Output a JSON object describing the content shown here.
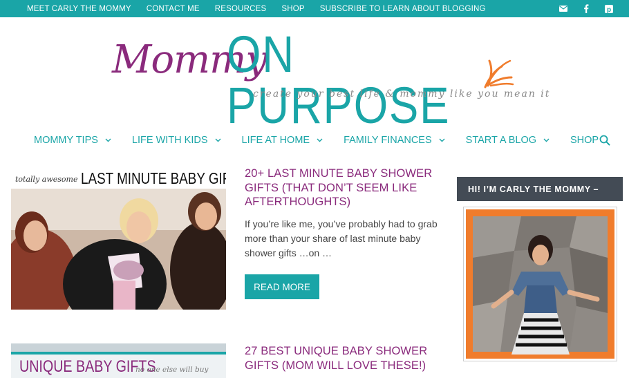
{
  "top_nav": {
    "items": [
      "MEET CARLY THE MOMMY",
      "CONTACT ME",
      "RESOURCES",
      "SHOP",
      "SUBSCRIBE TO LEARN ABOUT BLOGGING"
    ],
    "social_icons": [
      "email-icon",
      "facebook-icon",
      "pinterest-icon"
    ]
  },
  "logo": {
    "script": "Mommy",
    "main": "ON PURPOSE",
    "tagline": "create your best life & mommy like you mean it"
  },
  "main_nav": {
    "items": [
      "MOMMY TIPS",
      "LIFE WITH KIDS",
      "LIFE AT HOME",
      "FAMILY FINANCES",
      "START A BLOG",
      "SHOP"
    ]
  },
  "posts": [
    {
      "image_text_small": "totally awesome",
      "image_text_big": "LAST MINUTE BABY GIFTS",
      "title": "20+ LAST MINUTE BABY SHOWER GIFTS (THAT DON’T SEEM LIKE AFTERTHOUGHTS)",
      "excerpt": "If you’re like me, you’ve probably had to grab more than your share of last minute baby shower gifts …on …",
      "button": "READ MORE"
    },
    {
      "image_text_big": "UNIQUE BABY GIFTS",
      "image_text_small": "no one else will buy",
      "title": "27 BEST UNIQUE BABY SHOWER GIFTS (MOM WILL LOVE THESE!)"
    }
  ],
  "sidebar": {
    "widget_title": "HI! I’M CARLY THE MOMMY –"
  },
  "colors": {
    "teal": "#1aa5a7",
    "purple": "#8a2a7c",
    "dark_slate": "#434b55",
    "orange": "#f07c2c"
  }
}
